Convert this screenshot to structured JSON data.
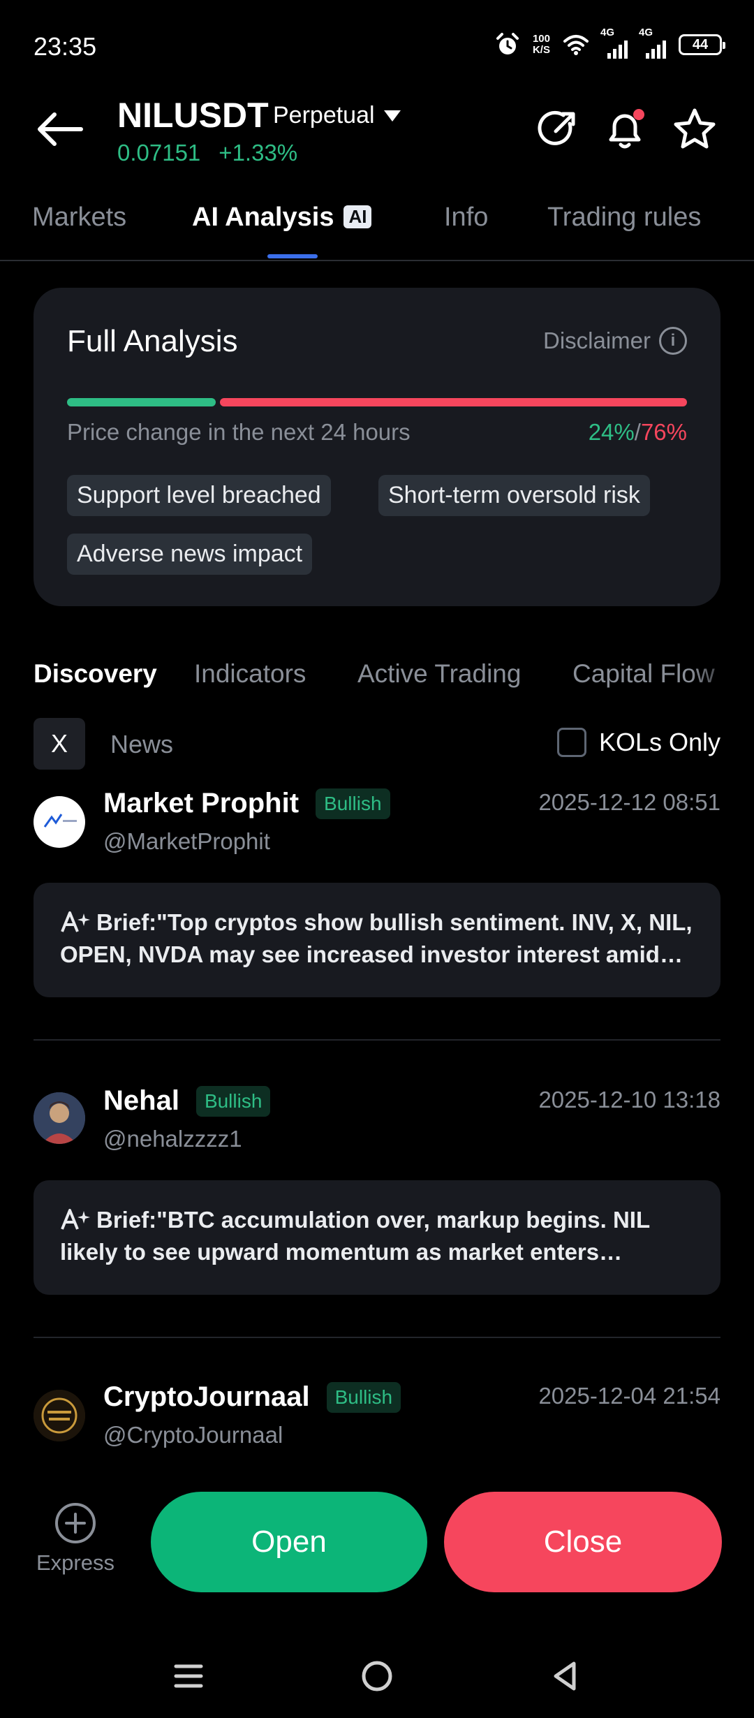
{
  "status_bar": {
    "time": "23:35",
    "net_speed_value": "100",
    "net_speed_unit": "K/S",
    "sim1_label": "4G",
    "sim2_label": "4G",
    "battery": "44"
  },
  "header": {
    "symbol": "NILUSDT",
    "contract_type": "Perpetual",
    "price": "0.07151",
    "change": "+1.33%"
  },
  "tabs": [
    {
      "label": "Markets"
    },
    {
      "label": "AI Analysis",
      "badge": "AI"
    },
    {
      "label": "Info"
    },
    {
      "label": "Trading rules"
    }
  ],
  "analysis": {
    "title": "Full Analysis",
    "disclaimer": "Disclaimer",
    "bullish_fraction": 0.24,
    "prob_label": "Price change in the next 24 hours",
    "up_pct": "24%",
    "separator": "/",
    "down_pct": "76%",
    "tags": [
      "Support level breached",
      "Short-term oversold risk",
      "Adverse news impact"
    ]
  },
  "subtabs": [
    "Discovery",
    "Indicators",
    "Active Trading",
    "Capital Flow"
  ],
  "filters": {
    "x_label": "X",
    "news_label": "News",
    "kol_label": "KOLs Only"
  },
  "posts": [
    {
      "name": "Market Prophit",
      "sentiment": "Bullish",
      "handle": "@MarketProphit",
      "time": "2025-12-12 08:51",
      "brief": "Brief:\"Top cryptos show bullish sentiment. INV, X, NIL, OPEN, NVDA may see increased investor interest amid favorable market conditions.\""
    },
    {
      "name": "Nehal",
      "sentiment": "Bullish",
      "handle": "@nehalzzzz1",
      "time": "2025-12-10 13:18",
      "brief": "Brief:\"BTC accumulation over, markup begins. NIL likely to see upward momentum as market enters aggressive phase.\""
    },
    {
      "name": "CryptoJournaal",
      "sentiment": "Bullish",
      "handle": "@CryptoJournaal",
      "time": "2025-12-04 21:54"
    }
  ],
  "actions": {
    "express": "Express",
    "open": "Open",
    "close": "Close"
  },
  "colors": {
    "bullish": "#2ebd85",
    "bearish": "#f6465d",
    "accent": "#3b6fea",
    "open_button": "#0cb578"
  }
}
